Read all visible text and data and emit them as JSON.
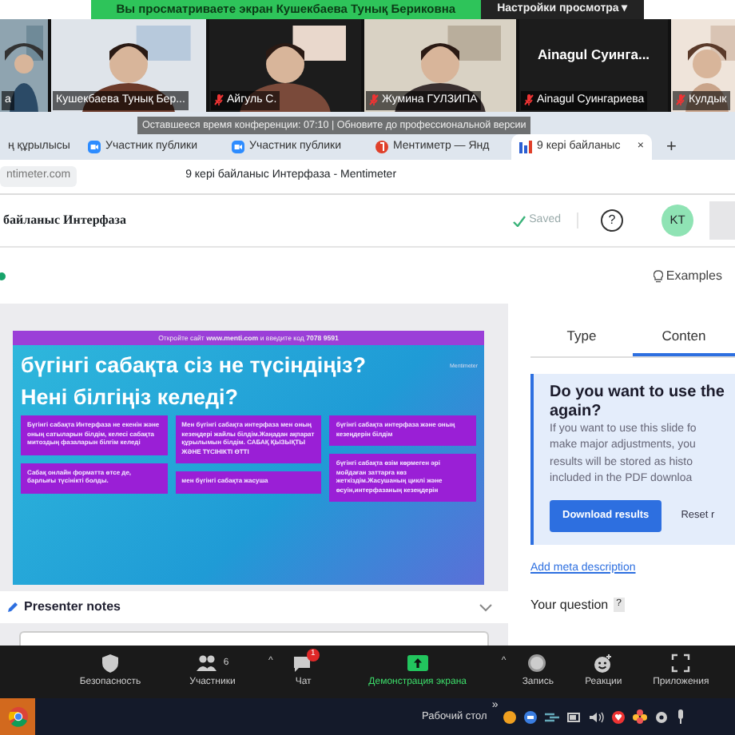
{
  "banner": {
    "text": "Вы просматриваете экран Кушекбаева Тунық Бериковна",
    "settings": "Настройки просмотра",
    "caret": "▾"
  },
  "participants": [
    {
      "name": "а",
      "kind": "video",
      "muted": false
    },
    {
      "name": "Кушекбаева Тунық Бер...",
      "kind": "video",
      "muted": false
    },
    {
      "name": "Айгуль С.",
      "kind": "video",
      "muted": true
    },
    {
      "name": "Жумина ГУЛЗИПА",
      "kind": "video",
      "muted": true
    },
    {
      "name": "Ainagul Суингариева",
      "kind": "avatar",
      "display": "Ainagul  Суинга...",
      "muted": true
    },
    {
      "name": "Кулдык",
      "kind": "video",
      "muted": true
    }
  ],
  "browser": {
    "tabs": [
      {
        "label": "ң құрылысы",
        "selected": false
      },
      {
        "label": "Участник публики",
        "selected": false
      },
      {
        "label": "Участник публики",
        "selected": false
      },
      {
        "label": "Ментиметр — Янд",
        "selected": false
      },
      {
        "label": "9 кері байланыс",
        "selected": true
      }
    ],
    "new_tab": "+",
    "close": "×",
    "tooltip": "Оставшееся время конференции: 07:10 | Обновите до профессиональной версии",
    "address": "ntimeter.com",
    "page_title": "9 кері байланыс Интерфаза - Mentimeter"
  },
  "app": {
    "title": "байланыс Интерфаза",
    "saved": "Saved",
    "help": "?",
    "avatar": "KT",
    "examples": "Examples"
  },
  "slide": {
    "banner": "Откройте сайт **www.menti.com** и введите код **7078 9591**",
    "brand": "Mentimeter",
    "question": [
      "бүгінгі сабақта сіз не түсіндіңіз?",
      "Нені білгіңіз келеді?"
    ],
    "columns": [
      [
        "Бүгінгі сабақта Интерфаза не екенін және оның сатыларын білдім, келесі сабақта митоздың фазаларын білгім келеді",
        "Сабақ онлайн форматта өтсе де, барлығы түсінікті болды."
      ],
      [
        "Мен бүгінгі сабақта интерфаза мен оның кезеңдері жайлы білдім.Жаңадан ақпарат құрылымын білдім. САБАҚ ҚЫЗЫҚТЫ ЖӘНЕ ТҮСІНІКТІ ӨТТІ",
        "мен бүгінгі сабақта жасуша"
      ],
      [
        "бүгінгі сабақта интерфаза және оның кезеңдерін білдім",
        "бүгінгі сабақта өзім көрмеген әрі мойдаған заттарға көз жеткіздім.Жасушаның циклі және өсуін,интерфазаның кезеңдерін"
      ]
    ]
  },
  "notes": {
    "label": "Presenter notes"
  },
  "panel": {
    "tabs": [
      {
        "label": "Type",
        "selected": false
      },
      {
        "label": "Conten",
        "selected": true
      }
    ],
    "info_title": [
      "Do you want to use the",
      "again?"
    ],
    "info_body": [
      "If you want to use this slide fo",
      "make major adjustments, you",
      "results will be stored as histo",
      "included in the PDF downloa"
    ],
    "download": "Download results",
    "reset": "Reset r",
    "meta_link": "Add meta description",
    "question_label": "Your question",
    "question_help": "?"
  },
  "toolbar": [
    {
      "label": "Безопасность",
      "highlight": false
    },
    {
      "label": "Участники",
      "count": "6",
      "caret": "^",
      "highlight": false
    },
    {
      "label": "Чат",
      "badge": "1",
      "highlight": false
    },
    {
      "label": "Демонстрация экрана",
      "caret": "^",
      "highlight": true
    },
    {
      "label": "Запись",
      "highlight": false
    },
    {
      "label": "Реакции",
      "highlight": false
    },
    {
      "label": "Приложения",
      "highlight": false
    }
  ],
  "taskbar": {
    "desktop": "Рабочий стол",
    "more": "»"
  }
}
